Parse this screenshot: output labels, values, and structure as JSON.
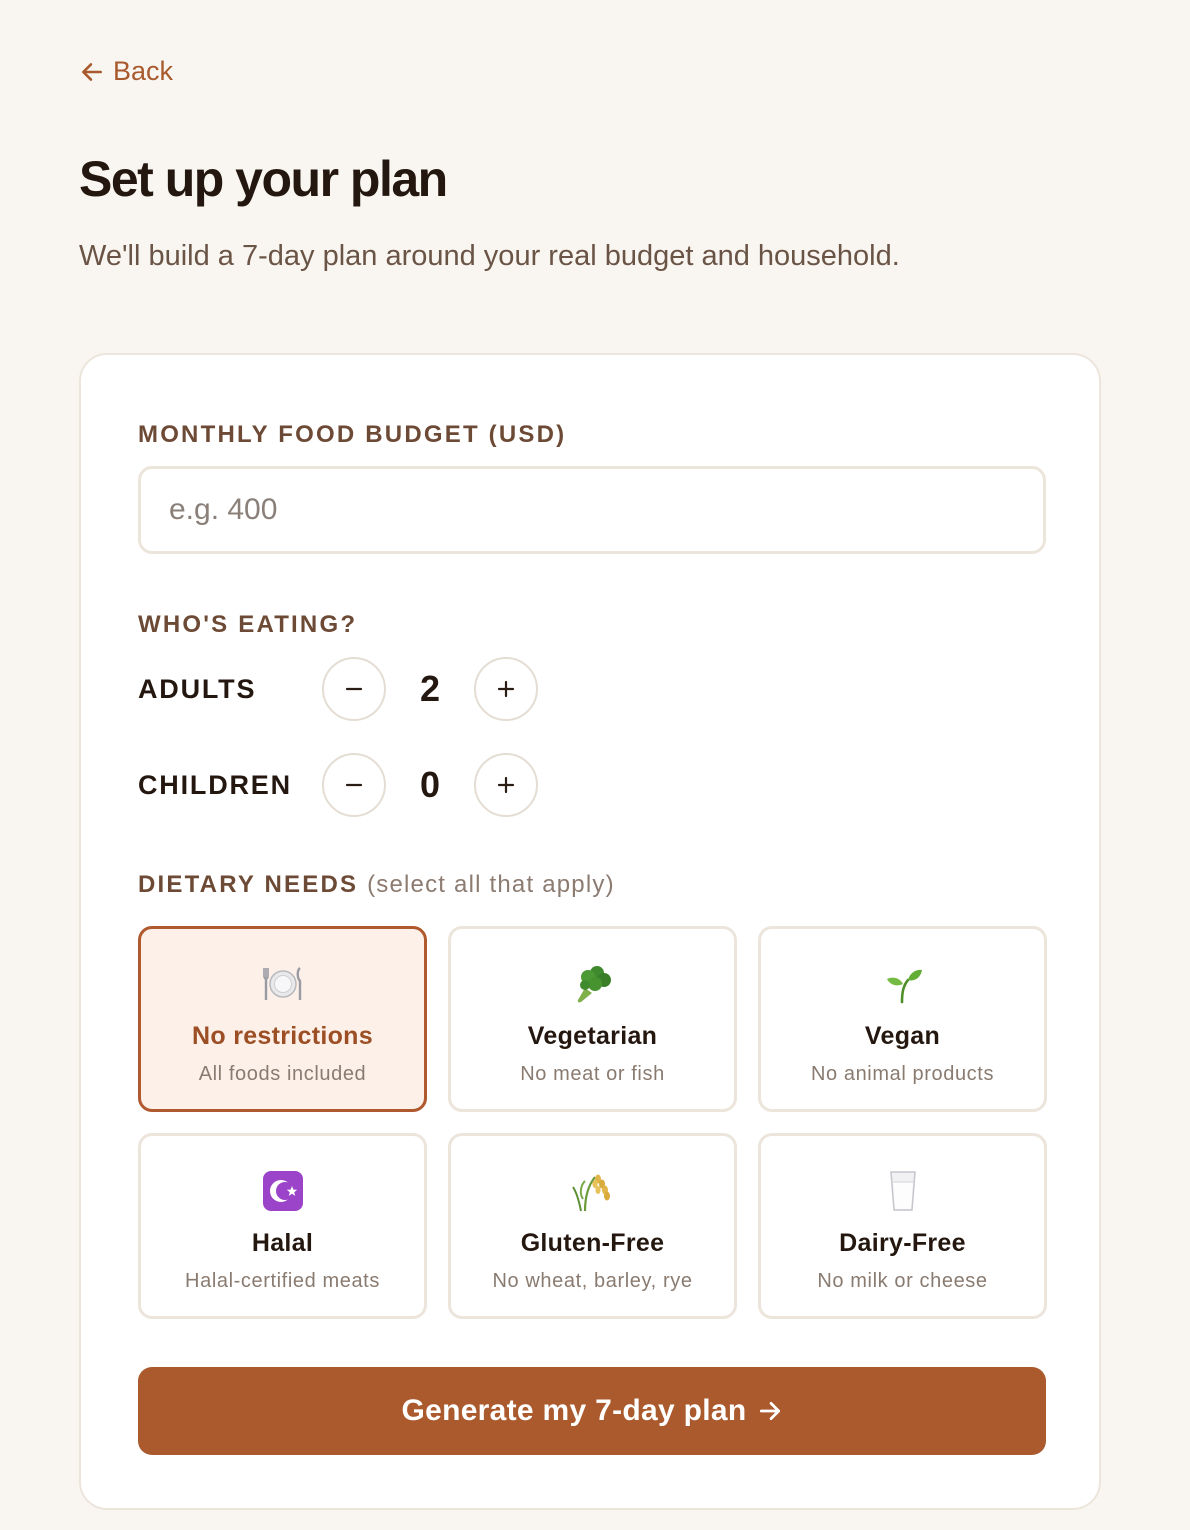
{
  "nav": {
    "back_label": "Back"
  },
  "header": {
    "title": "Set up your plan",
    "subtitle": "We'll build a 7-day plan around your real budget and household."
  },
  "form": {
    "budget": {
      "label": "MONTHLY FOOD BUDGET (USD)",
      "placeholder": "e.g. 400",
      "value": ""
    },
    "household": {
      "label": "WHO'S EATING?",
      "adults": {
        "label": "ADULTS",
        "value": "2"
      },
      "children": {
        "label": "CHILDREN",
        "value": "0"
      }
    },
    "dietary": {
      "label": "DIETARY NEEDS",
      "hint": "(select all that apply)",
      "options": [
        {
          "name": "No restrictions",
          "desc": "All foods included",
          "icon": "plate-cutlery-icon",
          "selected": true
        },
        {
          "name": "Vegetarian",
          "desc": "No meat or fish",
          "icon": "broccoli-icon",
          "selected": false
        },
        {
          "name": "Vegan",
          "desc": "No animal products",
          "icon": "seedling-icon",
          "selected": false
        },
        {
          "name": "Halal",
          "desc": "Halal-certified meats",
          "icon": "star-crescent-icon",
          "selected": false
        },
        {
          "name": "Gluten-Free",
          "desc": "No wheat, barley, rye",
          "icon": "rice-stalk-icon",
          "selected": false
        },
        {
          "name": "Dairy-Free",
          "desc": "No milk or cheese",
          "icon": "milk-glass-icon",
          "selected": false
        }
      ]
    },
    "submit_label": "Generate my 7-day plan"
  },
  "colors": {
    "accent": "#ab5a2d",
    "background": "#f9f6f1",
    "selected_bg": "#fcf0e8"
  }
}
